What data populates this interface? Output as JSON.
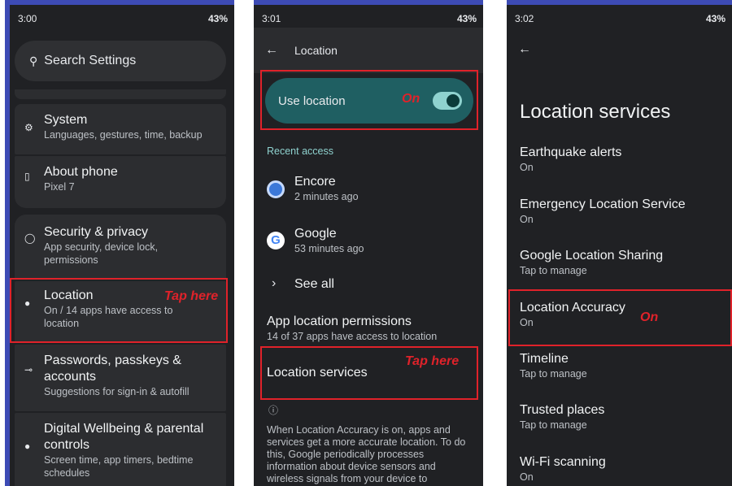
{
  "panel1": {
    "time": "3:00",
    "battery": "43%",
    "search_placeholder": "Search Settings",
    "system": {
      "title": "System",
      "sub": "Languages, gestures, time, backup"
    },
    "about": {
      "title": "About phone",
      "sub": "Pixel 7"
    },
    "security": {
      "title": "Security & privacy",
      "sub": "App security, device lock, permissions"
    },
    "location": {
      "title": "Location",
      "sub": "On / 14 apps have access to location"
    },
    "passwords": {
      "title": "Passwords, passkeys & accounts",
      "sub": "Suggestions for sign-in & autofill"
    },
    "wellbeing": {
      "title": "Digital Wellbeing & parental controls",
      "sub": "Screen time, app timers, bedtime schedules"
    },
    "callout": "Tap here"
  },
  "panel2": {
    "time": "3:01",
    "battery": "43%",
    "title": "Location",
    "use_location": "Use location",
    "use_location_callout": "On",
    "recent_access": "Recent access",
    "apps": [
      {
        "name": "Encore",
        "time": "2 minutes ago"
      },
      {
        "name": "Google",
        "time": "53 minutes ago"
      }
    ],
    "see_all": "See all",
    "app_permissions": {
      "title": "App location permissions",
      "sub": "14 of 37 apps have access to location"
    },
    "location_services": "Location services",
    "callout": "Tap here",
    "footer": "When Location Accuracy is on, apps and services get a more accurate location. To do this, Google periodically processes information about device sensors and wireless signals from your device to"
  },
  "panel3": {
    "time": "3:02",
    "battery": "43%",
    "title": "Location services",
    "items": [
      {
        "title": "Earthquake alerts",
        "sub": "On"
      },
      {
        "title": "Emergency Location Service",
        "sub": "On"
      },
      {
        "title": "Google Location Sharing",
        "sub": "Tap to manage"
      },
      {
        "title": "Location Accuracy",
        "sub": "On"
      },
      {
        "title": "Timeline",
        "sub": "Tap to manage"
      },
      {
        "title": "Trusted places",
        "sub": "Tap to manage"
      },
      {
        "title": "Wi-Fi scanning",
        "sub": "On"
      }
    ],
    "callout": "On"
  }
}
